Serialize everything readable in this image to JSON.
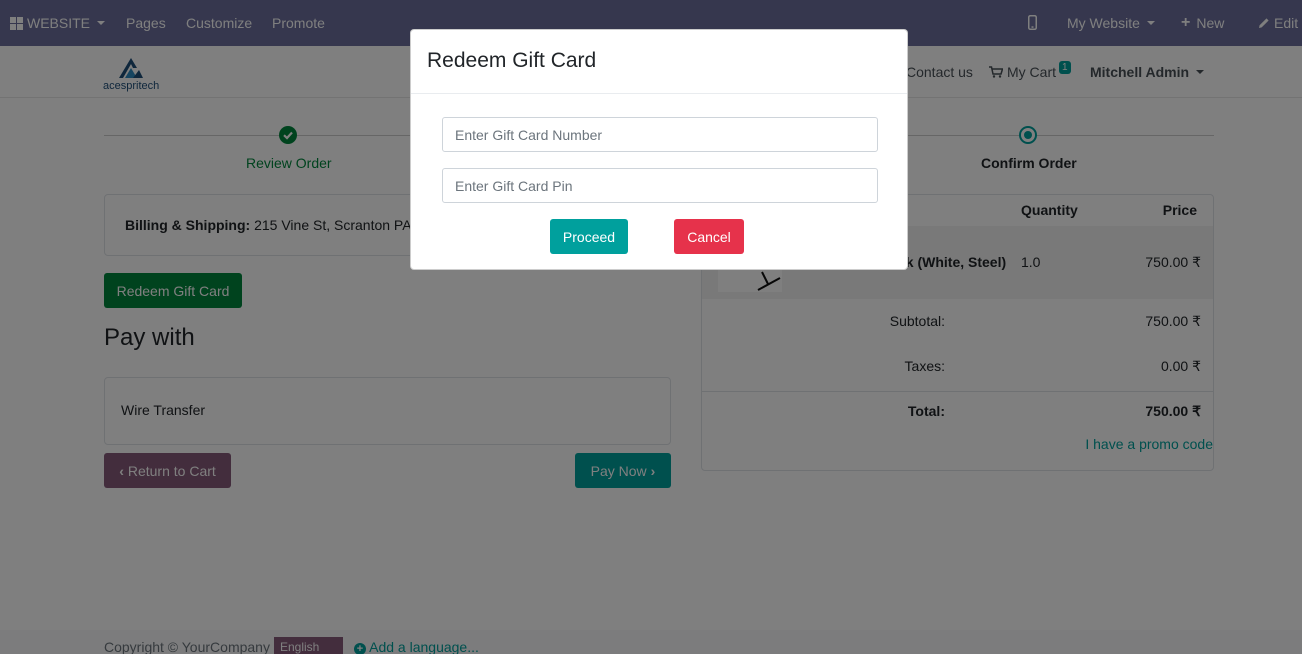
{
  "topbar": {
    "website_label": "WEBSITE",
    "menu": [
      "Pages",
      "Customize",
      "Promote"
    ],
    "my_website": "My Website",
    "new_label": "New",
    "edit_label": "Edit",
    "color": "#6c6f9c"
  },
  "navbar": {
    "logo_text": "acespritech",
    "contact": "Contact us",
    "cart_label": "My Cart",
    "cart_count": "1",
    "user": "Mitchell Admin"
  },
  "progress": {
    "step1": "Review Order",
    "step3": "Confirm Order"
  },
  "billing": {
    "label": "Billing & Shipping:",
    "address": "215 Vine St, Scranton PA"
  },
  "redeem_button": "Redeem Gift Card",
  "pay_with": {
    "title": "Pay with",
    "method": "Wire Transfer"
  },
  "actions": {
    "return_cart": "Return to Cart",
    "pay_now": "Pay Now"
  },
  "order_summary": {
    "col_quantity": "Quantity",
    "col_price": "Price",
    "product_name": "sk (White, Steel)",
    "product_qty": "1.0",
    "product_price": "750.00 ₹",
    "subtotal_label": "Subtotal:",
    "subtotal": "750.00 ₹",
    "taxes_label": "Taxes:",
    "taxes": "0.00 ₹",
    "total_label": "Total:",
    "total": "750.00 ₹",
    "promo": "I have a promo code"
  },
  "footer": {
    "copyright": "Copyright © YourCompany",
    "language": "English",
    "add_language": "Add a language..."
  },
  "modal": {
    "title": "Redeem Gift Card",
    "card_number_placeholder": "Enter Gift Card Number",
    "card_pin_placeholder": "Enter Gift Card Pin",
    "proceed": "Proceed",
    "cancel": "Cancel"
  },
  "colors": {
    "green": "#00863d",
    "teal": "#00a09d",
    "plum": "#875a7b",
    "red": "#e6324b"
  }
}
